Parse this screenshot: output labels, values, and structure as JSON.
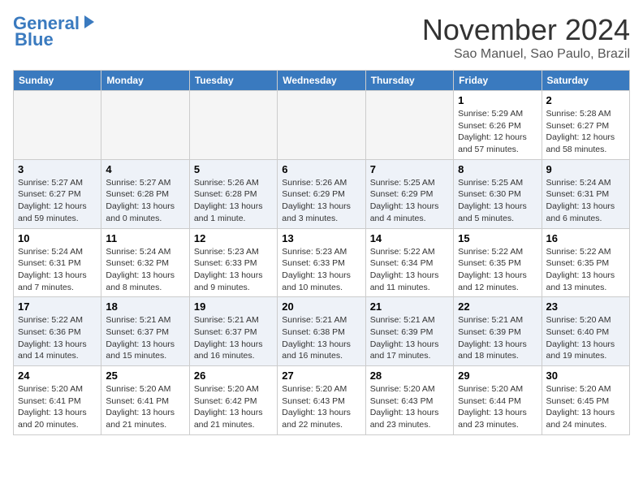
{
  "header": {
    "logo_line1": "General",
    "logo_line2": "Blue",
    "month": "November 2024",
    "location": "Sao Manuel, Sao Paulo, Brazil"
  },
  "days_of_week": [
    "Sunday",
    "Monday",
    "Tuesday",
    "Wednesday",
    "Thursday",
    "Friday",
    "Saturday"
  ],
  "weeks": [
    [
      {
        "day": "",
        "empty": true
      },
      {
        "day": "",
        "empty": true
      },
      {
        "day": "",
        "empty": true
      },
      {
        "day": "",
        "empty": true
      },
      {
        "day": "",
        "empty": true
      },
      {
        "day": "1",
        "sunrise": "5:29 AM",
        "sunset": "6:26 PM",
        "daylight": "12 hours and 57 minutes."
      },
      {
        "day": "2",
        "sunrise": "5:28 AM",
        "sunset": "6:27 PM",
        "daylight": "12 hours and 58 minutes."
      }
    ],
    [
      {
        "day": "3",
        "sunrise": "5:27 AM",
        "sunset": "6:27 PM",
        "daylight": "12 hours and 59 minutes."
      },
      {
        "day": "4",
        "sunrise": "5:27 AM",
        "sunset": "6:28 PM",
        "daylight": "13 hours and 0 minutes."
      },
      {
        "day": "5",
        "sunrise": "5:26 AM",
        "sunset": "6:28 PM",
        "daylight": "13 hours and 1 minute."
      },
      {
        "day": "6",
        "sunrise": "5:26 AM",
        "sunset": "6:29 PM",
        "daylight": "13 hours and 3 minutes."
      },
      {
        "day": "7",
        "sunrise": "5:25 AM",
        "sunset": "6:29 PM",
        "daylight": "13 hours and 4 minutes."
      },
      {
        "day": "8",
        "sunrise": "5:25 AM",
        "sunset": "6:30 PM",
        "daylight": "13 hours and 5 minutes."
      },
      {
        "day": "9",
        "sunrise": "5:24 AM",
        "sunset": "6:31 PM",
        "daylight": "13 hours and 6 minutes."
      }
    ],
    [
      {
        "day": "10",
        "sunrise": "5:24 AM",
        "sunset": "6:31 PM",
        "daylight": "13 hours and 7 minutes."
      },
      {
        "day": "11",
        "sunrise": "5:24 AM",
        "sunset": "6:32 PM",
        "daylight": "13 hours and 8 minutes."
      },
      {
        "day": "12",
        "sunrise": "5:23 AM",
        "sunset": "6:33 PM",
        "daylight": "13 hours and 9 minutes."
      },
      {
        "day": "13",
        "sunrise": "5:23 AM",
        "sunset": "6:33 PM",
        "daylight": "13 hours and 10 minutes."
      },
      {
        "day": "14",
        "sunrise": "5:22 AM",
        "sunset": "6:34 PM",
        "daylight": "13 hours and 11 minutes."
      },
      {
        "day": "15",
        "sunrise": "5:22 AM",
        "sunset": "6:35 PM",
        "daylight": "13 hours and 12 minutes."
      },
      {
        "day": "16",
        "sunrise": "5:22 AM",
        "sunset": "6:35 PM",
        "daylight": "13 hours and 13 minutes."
      }
    ],
    [
      {
        "day": "17",
        "sunrise": "5:22 AM",
        "sunset": "6:36 PM",
        "daylight": "13 hours and 14 minutes."
      },
      {
        "day": "18",
        "sunrise": "5:21 AM",
        "sunset": "6:37 PM",
        "daylight": "13 hours and 15 minutes."
      },
      {
        "day": "19",
        "sunrise": "5:21 AM",
        "sunset": "6:37 PM",
        "daylight": "13 hours and 16 minutes."
      },
      {
        "day": "20",
        "sunrise": "5:21 AM",
        "sunset": "6:38 PM",
        "daylight": "13 hours and 16 minutes."
      },
      {
        "day": "21",
        "sunrise": "5:21 AM",
        "sunset": "6:39 PM",
        "daylight": "13 hours and 17 minutes."
      },
      {
        "day": "22",
        "sunrise": "5:21 AM",
        "sunset": "6:39 PM",
        "daylight": "13 hours and 18 minutes."
      },
      {
        "day": "23",
        "sunrise": "5:20 AM",
        "sunset": "6:40 PM",
        "daylight": "13 hours and 19 minutes."
      }
    ],
    [
      {
        "day": "24",
        "sunrise": "5:20 AM",
        "sunset": "6:41 PM",
        "daylight": "13 hours and 20 minutes."
      },
      {
        "day": "25",
        "sunrise": "5:20 AM",
        "sunset": "6:41 PM",
        "daylight": "13 hours and 21 minutes."
      },
      {
        "day": "26",
        "sunrise": "5:20 AM",
        "sunset": "6:42 PM",
        "daylight": "13 hours and 21 minutes."
      },
      {
        "day": "27",
        "sunrise": "5:20 AM",
        "sunset": "6:43 PM",
        "daylight": "13 hours and 22 minutes."
      },
      {
        "day": "28",
        "sunrise": "5:20 AM",
        "sunset": "6:43 PM",
        "daylight": "13 hours and 23 minutes."
      },
      {
        "day": "29",
        "sunrise": "5:20 AM",
        "sunset": "6:44 PM",
        "daylight": "13 hours and 23 minutes."
      },
      {
        "day": "30",
        "sunrise": "5:20 AM",
        "sunset": "6:45 PM",
        "daylight": "13 hours and 24 minutes."
      }
    ]
  ]
}
